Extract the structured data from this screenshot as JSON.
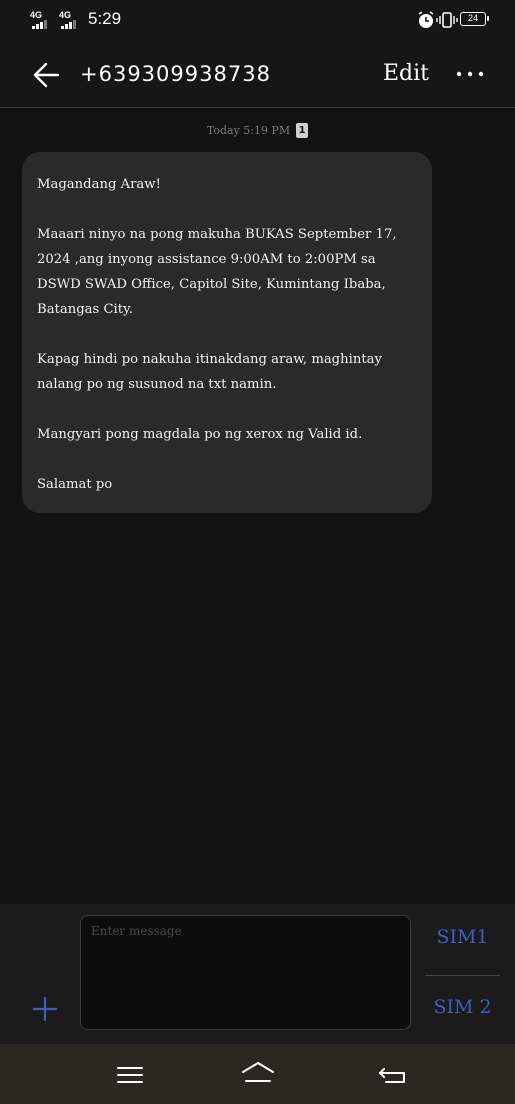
{
  "status_bar": {
    "network1": "4G",
    "network2": "4G",
    "time": "5:29",
    "battery": "24"
  },
  "header": {
    "contact": "+639309938738",
    "edit_label": "Edit"
  },
  "conversation": {
    "timestamp": "Today 5:19 PM",
    "sim_badge": "1",
    "message": {
      "greeting": "Magandang Araw!",
      "body1": "Maaari ninyo na pong makuha BUKAS September 17, 2024 ,ang inyong assistance 9:00AM to 2:00PM sa DSWD SWAD Office, Capitol Site, Kumintang Ibaba, Batangas City.",
      "body2": "Kapag hindi po nakuha itinakdang araw, maghintay nalang po ng susunod na txt namin.",
      "body3": "Mangyari pong magdala po ng xerox ng Valid id.",
      "closing": "Salamat po"
    }
  },
  "composer": {
    "placeholder": "Enter message",
    "sim1_label": "SIM1",
    "sim2_label": "SIM 2"
  },
  "colors": {
    "accent": "#3d5fc4",
    "bubble": "#2a2a2a",
    "background": "#121212"
  },
  "icons": [
    "back-arrow-icon",
    "more-options-icon",
    "alarm-icon",
    "vibrate-icon",
    "battery-icon",
    "add-icon",
    "nav-menu-icon",
    "nav-home-icon",
    "nav-back-icon"
  ]
}
